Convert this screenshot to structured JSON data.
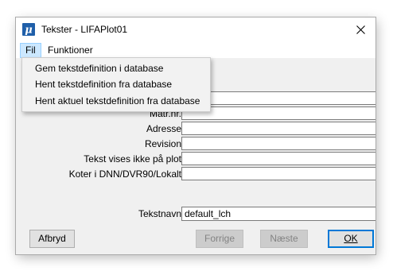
{
  "window": {
    "title": "Tekster - LIFAPlot01",
    "app_icon_glyph": "μ"
  },
  "menubar": {
    "items": [
      "Fil",
      "Funktioner"
    ]
  },
  "file_menu": {
    "items": [
      "Gem tekstdefinition i database",
      "Hent tekstdefinition fra database",
      "Hent aktuel tekstdefinition fra database"
    ]
  },
  "form": {
    "labels": [
      "Matr.nr.",
      "Adresse",
      "Revision",
      "Tekst vises ikke på plot",
      "Koter i DNN/DVR90/Lokalt"
    ],
    "tekstnavn_label": "Tekstnavn",
    "tekstnavn_value": "default_lch"
  },
  "buttons": {
    "cancel": "Afbryd",
    "previous": "Forrige",
    "next": "Næste",
    "ok": "OK"
  },
  "colors": {
    "accent": "#0078d7",
    "menu_highlight": "#cce8ff",
    "app_icon": "#1f5fa9"
  }
}
